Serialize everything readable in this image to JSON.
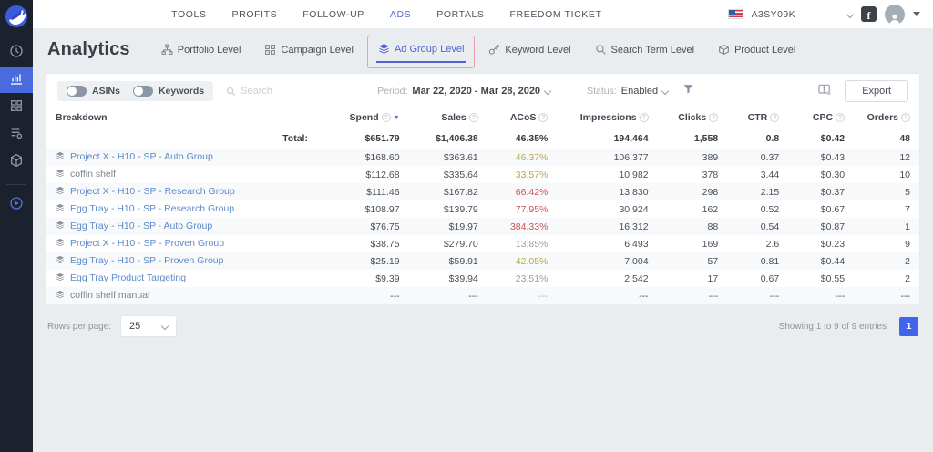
{
  "nav": {
    "items": [
      {
        "label": "TOOLS"
      },
      {
        "label": "PROFITS"
      },
      {
        "label": "FOLLOW-UP"
      },
      {
        "label": "ADS",
        "active": true
      },
      {
        "label": "PORTALS"
      },
      {
        "label": "FREEDOM TICKET"
      }
    ],
    "account_id": "A3SY09K",
    "icons": [
      "us-flag-icon",
      "chevron-down-icon",
      "facebook-icon",
      "user-avatar-icon"
    ]
  },
  "page": {
    "title": "Analytics"
  },
  "tabs": [
    {
      "label": "Portfolio Level",
      "icon": "sitemap-icon"
    },
    {
      "label": "Campaign Level",
      "icon": "grid-icon"
    },
    {
      "label": "Ad Group Level",
      "icon": "layers-icon",
      "active": true,
      "annotated": true
    },
    {
      "label": "Keyword Level",
      "icon": "key-icon"
    },
    {
      "label": "Search Term Level",
      "icon": "search-icon"
    },
    {
      "label": "Product Level",
      "icon": "package-icon"
    }
  ],
  "toolbar": {
    "toggles": [
      {
        "label": "ASINs",
        "on": false
      },
      {
        "label": "Keywords",
        "on": false
      }
    ],
    "search_placeholder": "Search",
    "period_label": "Period:",
    "period_value": "Mar 22, 2020 - Mar 28, 2020",
    "status_label": "Status:",
    "status_value": "Enabled",
    "export_label": "Export"
  },
  "table": {
    "columns": [
      "Breakdown",
      "Spend",
      "Sales",
      "ACoS",
      "Impressions",
      "Clicks",
      "CTR",
      "CPC",
      "Orders"
    ],
    "sorted_column": "Spend",
    "sort_direction": "desc",
    "total": {
      "label": "Total:",
      "spend": "$651.79",
      "sales": "$1,406.38",
      "acos": "46.35%",
      "impressions": "194,464",
      "clicks": "1,558",
      "ctr": "0.8",
      "cpc": "$0.42",
      "orders": "48"
    },
    "rows": [
      {
        "name": "Project X - H10 - SP - Auto Group",
        "name_style": "link",
        "spend": "$168.60",
        "sales": "$363.61",
        "acos": "46.37%",
        "acos_style": "warn",
        "impressions": "106,377",
        "clicks": "389",
        "ctr": "0.37",
        "cpc": "$0.43",
        "orders": "12"
      },
      {
        "name": "coffin shelf",
        "name_style": "muted",
        "spend": "$112.68",
        "sales": "$335.64",
        "acos": "33.57%",
        "acos_style": "warn",
        "impressions": "10,982",
        "clicks": "378",
        "ctr": "3.44",
        "cpc": "$0.30",
        "orders": "10"
      },
      {
        "name": "Project X - H10 - SP - Research Group",
        "name_style": "link",
        "spend": "$111.46",
        "sales": "$167.82",
        "acos": "66.42%",
        "acos_style": "bad",
        "impressions": "13,830",
        "clicks": "298",
        "ctr": "2.15",
        "cpc": "$0.37",
        "orders": "5"
      },
      {
        "name": "Egg Tray - H10 - SP - Research Group",
        "name_style": "link",
        "spend": "$108.97",
        "sales": "$139.79",
        "acos": "77.95%",
        "acos_style": "bad",
        "impressions": "30,924",
        "clicks": "162",
        "ctr": "0.52",
        "cpc": "$0.67",
        "orders": "7"
      },
      {
        "name": "Egg Tray - H10 - SP - Auto Group",
        "name_style": "link",
        "spend": "$76.75",
        "sales": "$19.97",
        "acos": "384.33%",
        "acos_style": "bad",
        "impressions": "16,312",
        "clicks": "88",
        "ctr": "0.54",
        "cpc": "$0.87",
        "orders": "1"
      },
      {
        "name": "Project X - H10 - SP - Proven Group",
        "name_style": "link",
        "spend": "$38.75",
        "sales": "$279.70",
        "acos": "13.85%",
        "acos_style": "ok",
        "impressions": "6,493",
        "clicks": "169",
        "ctr": "2.6",
        "cpc": "$0.23",
        "orders": "9"
      },
      {
        "name": "Egg Tray - H10 - SP - Proven Group",
        "name_style": "link",
        "spend": "$25.19",
        "sales": "$59.91",
        "acos": "42.05%",
        "acos_style": "warn",
        "impressions": "7,004",
        "clicks": "57",
        "ctr": "0.81",
        "cpc": "$0.44",
        "orders": "2"
      },
      {
        "name": "Egg Tray Product Targeting",
        "name_style": "link",
        "spend": "$9.39",
        "sales": "$39.94",
        "acos": "23.51%",
        "acos_style": "ok",
        "impressions": "2,542",
        "clicks": "17",
        "ctr": "0.67",
        "cpc": "$0.55",
        "orders": "2"
      },
      {
        "name": "coffin shelf manual",
        "name_style": "muted",
        "spend": "---",
        "sales": "---",
        "acos": "---",
        "acos_style": "dash",
        "impressions": "---",
        "clicks": "---",
        "ctr": "---",
        "cpc": "---",
        "orders": "---"
      }
    ]
  },
  "footer": {
    "rows_per_page_label": "Rows per page:",
    "rows_per_page_value": "25",
    "showing_text": "Showing 1 to 9 of 9 entries",
    "page": "1"
  },
  "colors": {
    "accent": "#5263cf",
    "sidebar_active": "#4a6bdd",
    "link_blue": "#5e8ac7",
    "acos_warn": "#b8a94d",
    "acos_bad": "#cf5454",
    "acos_ok": "#9aa0a8",
    "page_button": "#4263eb",
    "annotation_pink": "#ef9da6"
  }
}
